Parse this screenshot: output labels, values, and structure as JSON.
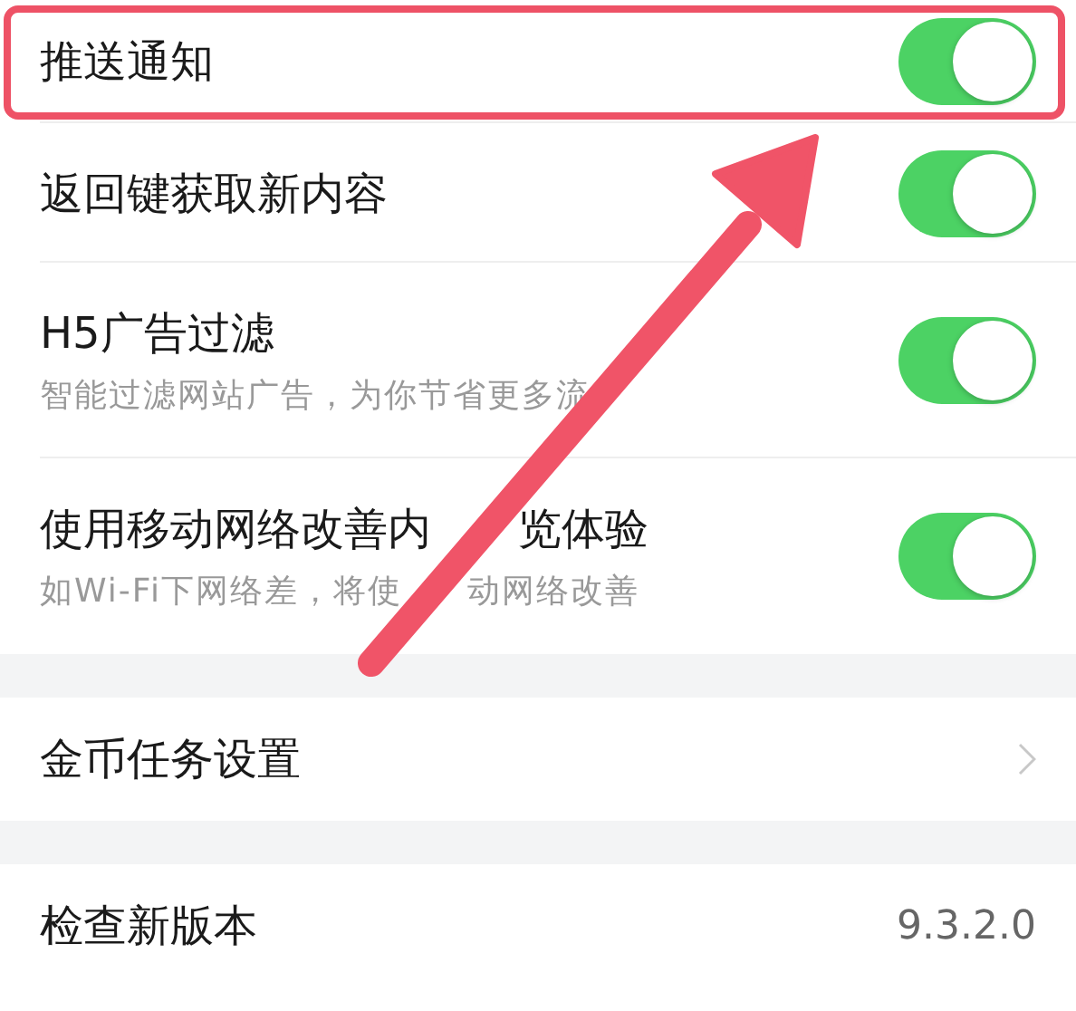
{
  "sections": [
    {
      "items": [
        {
          "kind": "toggle",
          "title": [
            "推送通知"
          ],
          "on": true,
          "highlighted": true
        },
        {
          "kind": "toggle",
          "title": [
            "返回键获取新内容"
          ],
          "on": true,
          "highlighted": false
        },
        {
          "kind": "toggle",
          "title": [
            "H5广告过滤"
          ],
          "subtitle": [
            "智能过滤网站广告，为你节省更多流"
          ],
          "on": true,
          "highlighted": false
        },
        {
          "kind": "toggle",
          "title": [
            "使用移动网络改善内",
            "览体验"
          ],
          "subtitle": [
            "如Wi-Fi下网络差，将使",
            "动网络改善"
          ],
          "on": true,
          "highlighted": false
        }
      ]
    },
    {
      "items": [
        {
          "kind": "link",
          "title": [
            "金币任务设置"
          ],
          "highlighted": false
        }
      ]
    },
    {
      "items": [
        {
          "kind": "value",
          "title": [
            "检查新版本"
          ],
          "value": "9.3.2.0",
          "highlighted": false
        }
      ]
    }
  ]
}
